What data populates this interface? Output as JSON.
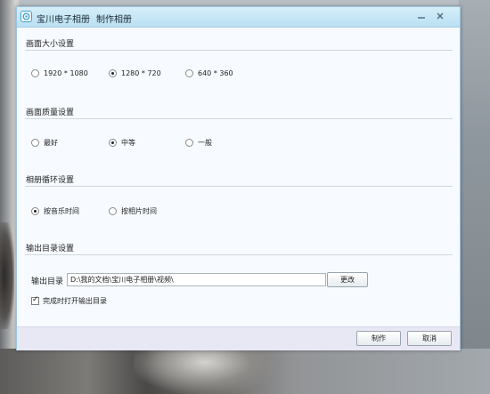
{
  "window": {
    "app_name": "宝川电子相册",
    "dialog_title": "制作相册"
  },
  "sections": {
    "resolution": {
      "title": "画面大小设置",
      "options": [
        {
          "label": "1920 * 1080",
          "selected": false
        },
        {
          "label": "1280 * 720",
          "selected": true
        },
        {
          "label": "640 * 360",
          "selected": false
        }
      ]
    },
    "quality": {
      "title": "画面质量设置",
      "options": [
        {
          "label": "最好",
          "selected": false
        },
        {
          "label": "中等",
          "selected": true
        },
        {
          "label": "一般",
          "selected": false
        }
      ]
    },
    "loop": {
      "title": "相册循环设置",
      "options": [
        {
          "label": "按音乐时间",
          "selected": true
        },
        {
          "label": "按相片时间",
          "selected": false
        }
      ]
    },
    "output": {
      "title": "输出目录设置",
      "field_label": "输出目录",
      "path_value": "D:\\我的文档\\宝川电子相册\\视频\\",
      "change_label": "更改",
      "open_after_label": "完成时打开输出目录",
      "open_after_checked": true
    }
  },
  "footer": {
    "create_label": "制作",
    "cancel_label": "取消"
  },
  "colors": {
    "titlebar": "#b9e0f2",
    "dialog_background": "#f7fbff",
    "footer_background": "#e8e8f5"
  },
  "icons": [
    "app-logo-icon",
    "minimize-icon",
    "close-icon",
    "check-icon"
  ]
}
